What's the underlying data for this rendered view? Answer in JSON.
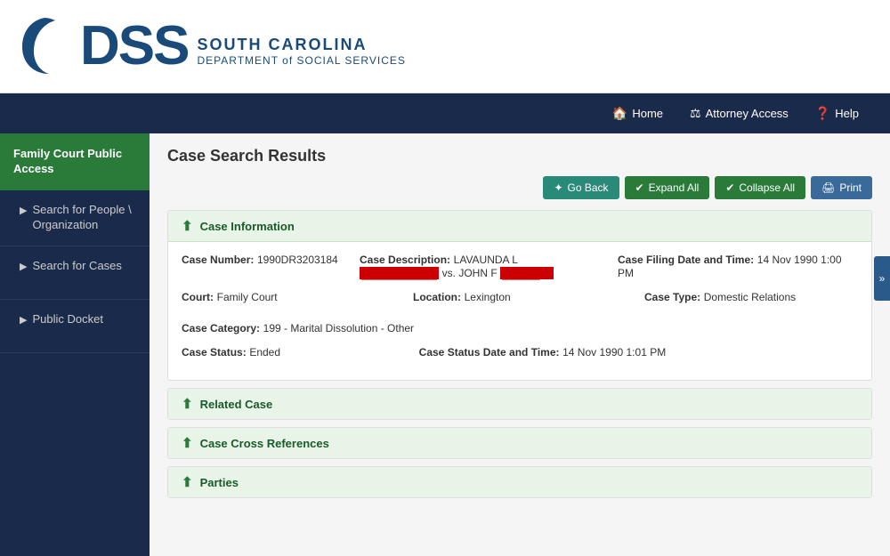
{
  "header": {
    "logo_dss": "DSS",
    "logo_sc": "SOUTH CAROLINA",
    "logo_dept": "DEPARTMENT of SOCIAL SERVICES"
  },
  "navbar": {
    "home_label": "Home",
    "attorney_label": "Attorney Access",
    "help_label": "Help"
  },
  "sidebar": {
    "section_title": "Family Court Public Access",
    "items": [
      {
        "label": "Search for People \\ Organization"
      },
      {
        "label": "Search for Cases"
      },
      {
        "label": "Public Docket"
      }
    ]
  },
  "main": {
    "page_title": "Case Search Results",
    "buttons": {
      "go_back": "Go Back",
      "expand_all": "Expand All",
      "collapse_all": "Collapse All",
      "print": "Print"
    },
    "sections": {
      "case_information": {
        "title": "Case Information",
        "fields": {
          "case_number_label": "Case Number:",
          "case_number_value": "1990DR3203184",
          "case_description_label": "Case Description:",
          "case_description_part1": "LAVAUNDA L",
          "case_description_redacted1": "██████████",
          "case_description_vs": "vs. JOHN F",
          "case_description_redacted2": "█████",
          "case_filing_label": "Case Filing Date and Time:",
          "case_filing_value": "14 Nov 1990 1:00 PM",
          "court_label": "Court:",
          "court_value": "Family Court",
          "location_label": "Location:",
          "location_value": "Lexington",
          "case_type_label": "Case Type:",
          "case_type_value": "Domestic Relations",
          "case_category_label": "Case Category:",
          "case_category_value": "199 - Marital Dissolution - Other",
          "case_status_label": "Case Status:",
          "case_status_value": "Ended",
          "case_status_date_label": "Case Status Date and Time:",
          "case_status_date_value": "14 Nov 1990 1:01 PM"
        }
      },
      "related_case": {
        "title": "Related Case"
      },
      "case_cross_references": {
        "title": "Case Cross References"
      },
      "parties": {
        "title": "Parties"
      }
    }
  }
}
